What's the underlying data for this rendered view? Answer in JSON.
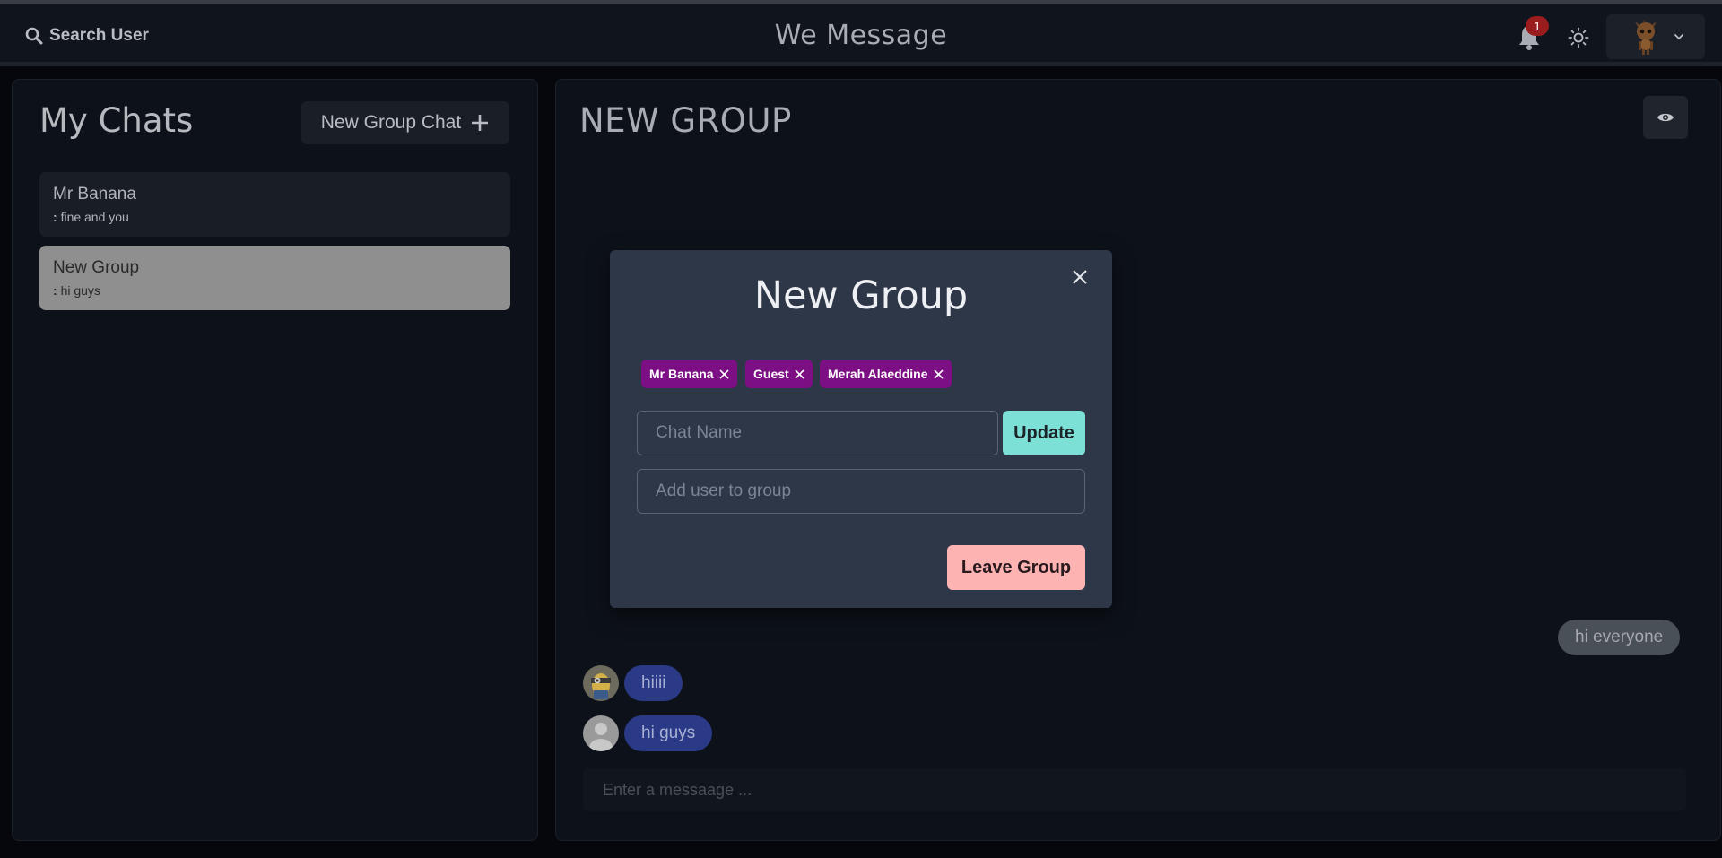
{
  "header": {
    "search_label": "Search User",
    "app_title": "We Message",
    "notification_count": "1"
  },
  "sidebar": {
    "title": "My Chats",
    "new_group_label": "New Group Chat",
    "chats": [
      {
        "name": "Mr Banana",
        "prefix": ":",
        "preview": "fine and you"
      },
      {
        "name": "New Group",
        "prefix": ":",
        "preview": "hi guys"
      }
    ]
  },
  "chat": {
    "title": "NEW GROUP",
    "messages": [
      {
        "text": "hi everyone",
        "own": true
      },
      {
        "text": "hiiii",
        "own": false
      },
      {
        "text": "hi guys",
        "own": false
      }
    ],
    "input_placeholder": "Enter a messaage ..."
  },
  "modal": {
    "title": "New Group",
    "members": [
      "Mr Banana",
      "Guest",
      "Merah Alaeddine"
    ],
    "chat_name_placeholder": "Chat Name",
    "update_label": "Update",
    "add_user_placeholder": "Add user to group",
    "leave_label": "Leave Group"
  },
  "colors": {
    "tag_purple": "#7d0f84",
    "update_teal": "#7de0d6",
    "leave_pink": "#feb3b3",
    "badge_red": "#9b1c1c",
    "message_blue": "#2b3a86"
  }
}
